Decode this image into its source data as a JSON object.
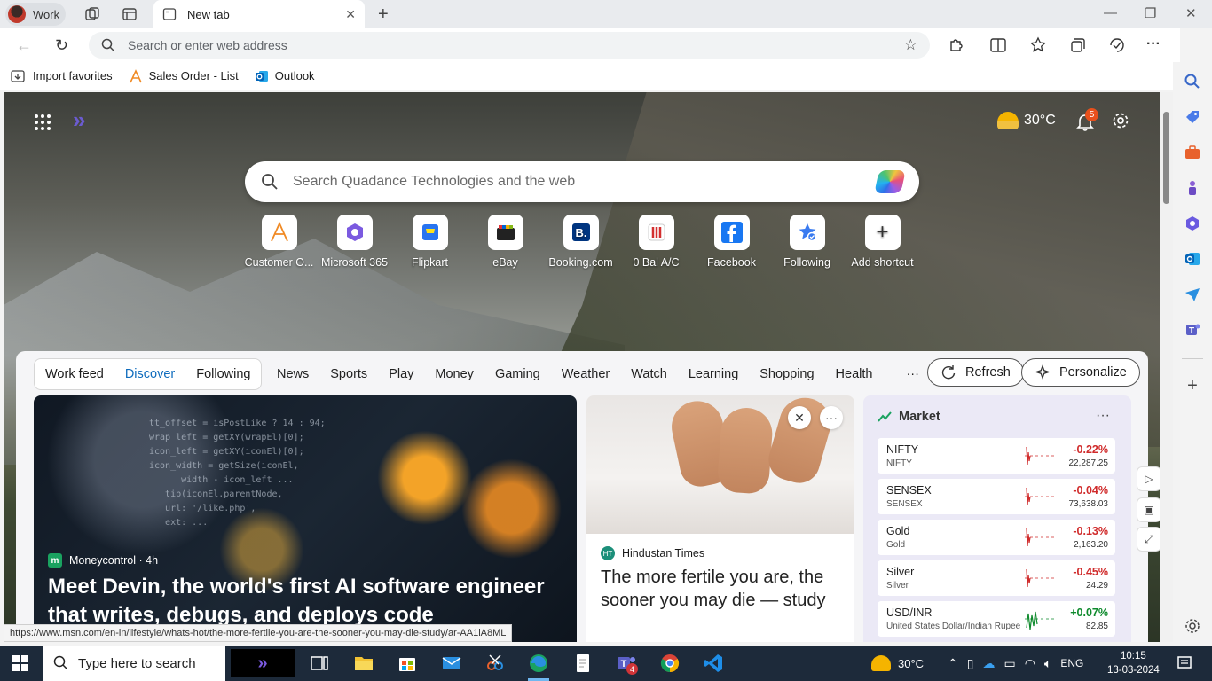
{
  "browser": {
    "profile_label": "Work",
    "tab_title": "New tab",
    "address_placeholder": "Search or enter web address",
    "favorites": [
      "Import favorites",
      "Sales Order - List",
      "Outlook"
    ],
    "status_url": "https://www.msn.com/en-in/lifestyle/whats-hot/the-more-fertile-you-are-the-sooner-you-may-die-study/ar-AA1lA8ML"
  },
  "newtab": {
    "weather_temp": "30°C",
    "notification_count": "5",
    "search_placeholder": "Search Quadance Technologies and the web",
    "shortcuts": [
      {
        "label": "Customer O...",
        "icon": "a-logo-icon"
      },
      {
        "label": "Microsoft 365",
        "icon": "m365-icon"
      },
      {
        "label": "Flipkart",
        "icon": "flipkart-icon"
      },
      {
        "label": "eBay",
        "icon": "ebay-icon"
      },
      {
        "label": "Booking.com",
        "icon": "booking-icon"
      },
      {
        "label": "0 Bal A/C",
        "icon": "bank-icon"
      },
      {
        "label": "Facebook",
        "icon": "facebook-icon"
      },
      {
        "label": "Following",
        "icon": "following-icon"
      },
      {
        "label": "Add shortcut",
        "icon": "plus-icon"
      }
    ]
  },
  "feed": {
    "segments": [
      "Work feed",
      "Discover",
      "Following"
    ],
    "active_segment": "Discover",
    "categories": [
      "News",
      "Sports",
      "Play",
      "Money",
      "Gaming",
      "Weather",
      "Watch",
      "Learning",
      "Shopping",
      "Health"
    ],
    "more": "···",
    "refresh_label": "Refresh",
    "personalize_label": "Personalize",
    "hero": {
      "source": "Moneycontrol · 4h",
      "headline": "Meet Devin, the world's first AI software engineer that writes, debugs, and deploys code"
    },
    "card2": {
      "source": "Hindustan Times",
      "headline": "The more fertile you are, the sooner you may die — study"
    },
    "market": {
      "title": "Market",
      "rows": [
        {
          "name": "NIFTY",
          "sub": "NIFTY",
          "change": "-0.22%",
          "value": "22,287.25",
          "trend": "neg"
        },
        {
          "name": "SENSEX",
          "sub": "SENSEX",
          "change": "-0.04%",
          "value": "73,638.03",
          "trend": "neg"
        },
        {
          "name": "Gold",
          "sub": "Gold",
          "change": "-0.13%",
          "value": "2,163.20",
          "trend": "neg"
        },
        {
          "name": "Silver",
          "sub": "Silver",
          "change": "-0.45%",
          "value": "24.29",
          "trend": "neg"
        },
        {
          "name": "USD/INR",
          "sub": "United States Dollar/Indian Rupee",
          "change": "+0.07%",
          "value": "82.85",
          "trend": "pos"
        }
      ]
    }
  },
  "taskbar": {
    "search_placeholder": "Type here to search",
    "weather": "30°C",
    "language": "ENG",
    "time": "10:15",
    "date": "13-03-2024",
    "teams_badge": "4"
  },
  "colors": {
    "accent": "#0f6cbd",
    "negative": "#d02b2b",
    "positive": "#0e8a2c",
    "taskbar": "#1d2a3a"
  }
}
